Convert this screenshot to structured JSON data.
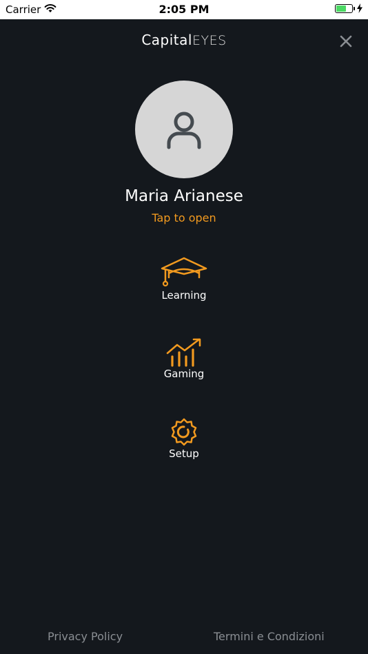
{
  "status_bar": {
    "carrier": "Carrier",
    "time": "2:05 PM",
    "battery_level": 0.6,
    "battery_color": "#4cd964"
  },
  "header": {
    "brand_primary": "Capital",
    "brand_secondary": "EYES",
    "close_icon": "close-icon"
  },
  "profile": {
    "avatar_icon": "user-icon",
    "name": "Maria Arianese",
    "tap_label": "Tap to open"
  },
  "menu": [
    {
      "icon": "graduation-cap-icon",
      "label": "Learning"
    },
    {
      "icon": "chart-growth-icon",
      "label": "Gaming"
    },
    {
      "icon": "gear-icon",
      "label": "Setup"
    }
  ],
  "footer": {
    "privacy": "Privacy Policy",
    "terms": "Termini e Condizioni"
  },
  "colors": {
    "background": "#14181d",
    "accent": "#f29a1f",
    "avatar_bg": "#d6d6d6",
    "avatar_icon": "#454b50",
    "footer_text": "#8a8e93"
  }
}
